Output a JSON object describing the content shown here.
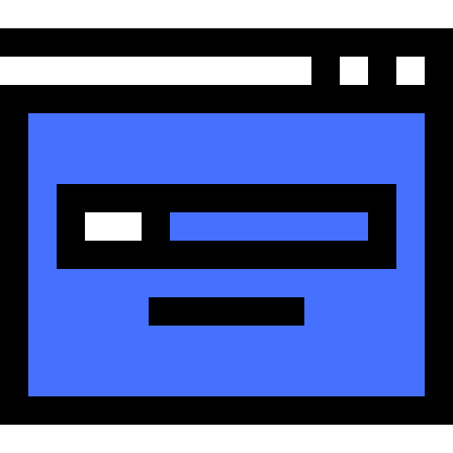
{
  "icon": {
    "name": "browser-window-login-icon",
    "colors": {
      "background": "#ffffff",
      "outline": "#000000",
      "fill": "#4671ff",
      "highlight": "#ffffff"
    }
  }
}
